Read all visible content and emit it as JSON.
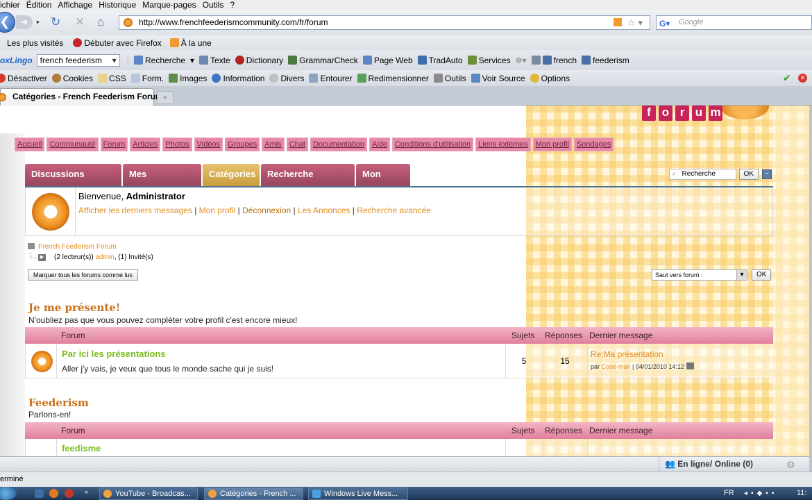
{
  "menu": [
    "ichier",
    "Édition",
    "Affichage",
    "Historique",
    "Marque-pages",
    "Outils",
    "?"
  ],
  "url": "http://www.frenchfeederismcommunity.com/fr/forum",
  "search_placeholder": "Google",
  "bookmarks": [
    "Les plus visités",
    "Débuter avec Firefox",
    "À la une"
  ],
  "toolbar1": {
    "oxlingo": "oxLingo",
    "dropdown_value": "french feederism",
    "items": [
      "Recherche",
      "Texte",
      "Dictionary",
      "GrammarCheck",
      "Page Web",
      "TradAuto",
      "Services"
    ],
    "words": [
      "french",
      "feederism"
    ]
  },
  "toolbar2": [
    "Désactiver",
    "Cookies",
    "CSS",
    "Form.",
    "Images",
    "Information",
    "Divers",
    "Entourer",
    "Redimensionner",
    "Outils",
    "Voir Source",
    "Options"
  ],
  "tab_title": "Catégories - French Feederism Forum",
  "logo_letters": [
    "f",
    "o",
    "r",
    "u",
    "m"
  ],
  "navlinks": [
    "Accueil",
    "Communauté",
    "Forum",
    "Articles",
    "Photos",
    "Vidéos",
    "Groupes",
    "Amis",
    "Chat",
    "Documentation",
    "Aide",
    "Conditions d'utilisation",
    "Liens externes",
    "Mon profil",
    "Sondages"
  ],
  "subtabs": [
    "Discussions récentes",
    "Mes Discussions",
    "Catégories",
    "Recherche avancée",
    "Mon profil"
  ],
  "search": {
    "placeholder": "Recherche",
    "ok": "OK"
  },
  "welcome": {
    "greeting": "Bienvenue, ",
    "user": "Administrator",
    "links": [
      "Afficher les derniers messages",
      "Mon profil",
      "Déconnexion",
      "Les Annonces",
      "Recherche avancée"
    ]
  },
  "breadcrumb": "French Feederism Forum",
  "online": {
    "pre": "(2 lecteur(s)) ",
    "user": "admin",
    "post": ", (1) Invité(s)"
  },
  "mark_read": "Marquer tous les forums comme lus",
  "jump": {
    "label": "Saut vers forum :",
    "ok": "OK"
  },
  "headers": {
    "forum": "Forum",
    "topics": "Sujets",
    "replies": "Réponses",
    "last": "Dernier message"
  },
  "categories": [
    {
      "title": "Je me présente!",
      "desc": "N'oubliez pas que vous pouvez compléter votre profil c'est encore mieux!",
      "forum": {
        "title": "Par ici les présentations",
        "desc": "Aller j'y vais, je veux que tous le monde sache qui je suis!",
        "topics": "5",
        "replies": "15",
        "last_title": "Re:Ma présentation",
        "last_by": "par ",
        "last_user": "Cooe-man",
        "last_date": " | 04/01/2010 14:12"
      }
    },
    {
      "title": "Feederism",
      "desc": "Parlons-en!",
      "forum": {
        "title": "feedisme"
      }
    }
  ],
  "online_bar": "En ligne/ Online (0)",
  "status": "erminé",
  "taskbar": {
    "tasks": [
      "YouTube - Broadcas...",
      "Catégories - French ...",
      "Windows Live Mess..."
    ],
    "lang": "FR",
    "clock": "11:"
  },
  "colors": {
    "accent_pink": "#e07f9c",
    "tab_active": "#c99c3b",
    "link_orange": "#e38c1f",
    "forum_green": "#7cbd23"
  }
}
